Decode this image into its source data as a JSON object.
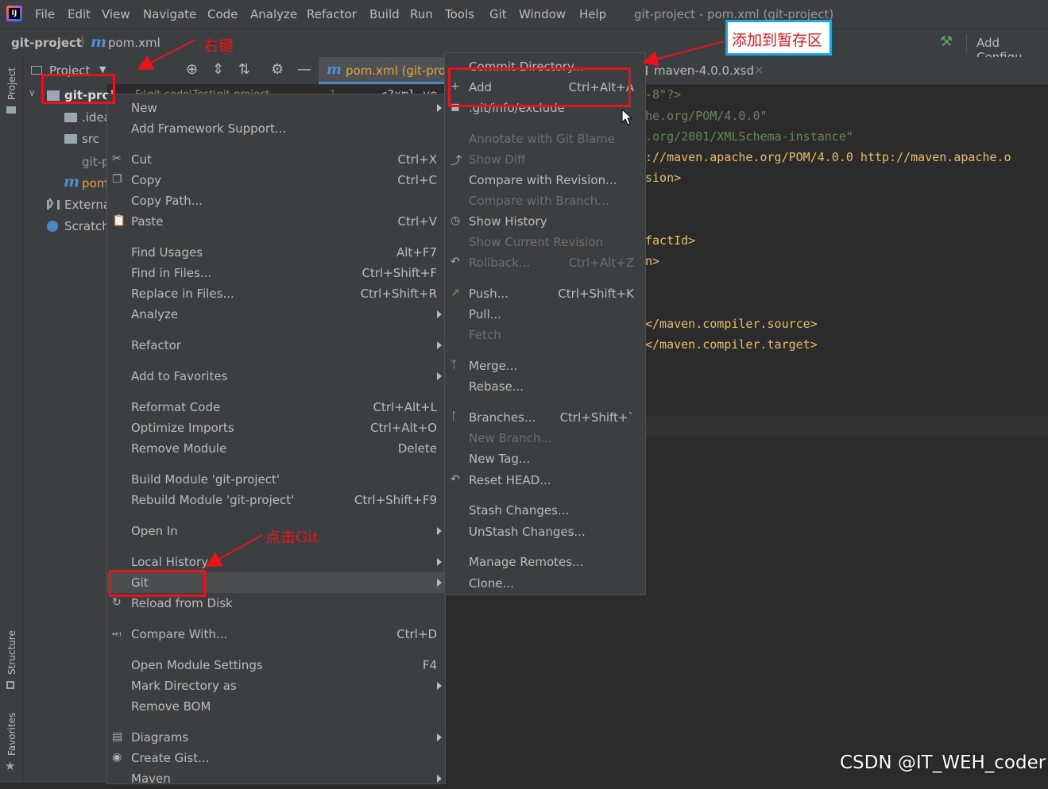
{
  "menubar": {
    "items": [
      "File",
      "Edit",
      "View",
      "Navigate",
      "Code",
      "Analyze",
      "Refactor",
      "Build",
      "Run",
      "Tools",
      "Git",
      "Window",
      "Help"
    ],
    "window_title": "git-project - pom.xml (git-project)"
  },
  "navbar": {
    "project": "git-project",
    "file": "pom.xml",
    "add_config": "Add Configu"
  },
  "tool_windows": {
    "project": "Project",
    "structure": "Structure",
    "favorites": "Favorites"
  },
  "project_panel": {
    "title": "Project",
    "tree": [
      "git-proj",
      "F:\\git-code\\Test\\git-project",
      ".idea",
      "src",
      "git-p",
      "pom",
      "Externa",
      "Scratch"
    ]
  },
  "editor": {
    "tabs": [
      "pom.xml (git-pro",
      "maven-4.0.0.xsd"
    ],
    "lines": [
      "-8\"?>",
      "he.org/POM/4.0.0\"",
      ".org/2001/XMLSchema-instance\"",
      "://maven.apache.org/POM/4.0.0 http://maven.apache.o",
      "sion>",
      "factId>",
      "n>",
      "</maven.compiler.source>",
      "</maven.compiler.target>"
    ],
    "fragment": "<?xml ve"
  },
  "context_menu": {
    "items": [
      {
        "label": "New",
        "shortcut": ""
      },
      {
        "label": "Add Framework Support...",
        "shortcut": ""
      },
      {
        "label": "Cut",
        "shortcut": "Ctrl+X"
      },
      {
        "label": "Copy",
        "shortcut": "Ctrl+C"
      },
      {
        "label": "Copy Path...",
        "shortcut": ""
      },
      {
        "label": "Paste",
        "shortcut": "Ctrl+V"
      },
      {
        "label": "Find Usages",
        "shortcut": "Alt+F7"
      },
      {
        "label": "Find in Files...",
        "shortcut": "Ctrl+Shift+F"
      },
      {
        "label": "Replace in Files...",
        "shortcut": "Ctrl+Shift+R"
      },
      {
        "label": "Analyze",
        "shortcut": ""
      },
      {
        "label": "Refactor",
        "shortcut": ""
      },
      {
        "label": "Add to Favorites",
        "shortcut": ""
      },
      {
        "label": "Reformat Code",
        "shortcut": "Ctrl+Alt+L"
      },
      {
        "label": "Optimize Imports",
        "shortcut": "Ctrl+Alt+O"
      },
      {
        "label": "Remove Module",
        "shortcut": "Delete"
      },
      {
        "label": "Build Module 'git-project'",
        "shortcut": ""
      },
      {
        "label": "Rebuild Module 'git-project'",
        "shortcut": "Ctrl+Shift+F9"
      },
      {
        "label": "Open In",
        "shortcut": ""
      },
      {
        "label": "Local History",
        "shortcut": ""
      },
      {
        "label": "Git",
        "shortcut": ""
      },
      {
        "label": "Reload from Disk",
        "shortcut": ""
      },
      {
        "label": "Compare With...",
        "shortcut": "Ctrl+D"
      },
      {
        "label": "Open Module Settings",
        "shortcut": "F4"
      },
      {
        "label": "Mark Directory as",
        "shortcut": ""
      },
      {
        "label": "Remove BOM",
        "shortcut": ""
      },
      {
        "label": "Diagrams",
        "shortcut": ""
      },
      {
        "label": "Create Gist...",
        "shortcut": ""
      },
      {
        "label": "Maven",
        "shortcut": ""
      }
    ]
  },
  "git_submenu": {
    "items": [
      {
        "label": "Commit Directory...",
        "shortcut": ""
      },
      {
        "label": "Add",
        "shortcut": "Ctrl+Alt+A"
      },
      {
        "label": ".git/info/exclude",
        "shortcut": ""
      },
      {
        "label": "Annotate with Git Blame",
        "shortcut": ""
      },
      {
        "label": "Show Diff",
        "shortcut": ""
      },
      {
        "label": "Compare with Revision...",
        "shortcut": ""
      },
      {
        "label": "Compare with Branch...",
        "shortcut": ""
      },
      {
        "label": "Show History",
        "shortcut": ""
      },
      {
        "label": "Show Current Revision",
        "shortcut": ""
      },
      {
        "label": "Rollback...",
        "shortcut": "Ctrl+Alt+Z"
      },
      {
        "label": "Push...",
        "shortcut": "Ctrl+Shift+K"
      },
      {
        "label": "Pull...",
        "shortcut": ""
      },
      {
        "label": "Fetch",
        "shortcut": ""
      },
      {
        "label": "Merge...",
        "shortcut": ""
      },
      {
        "label": "Rebase...",
        "shortcut": ""
      },
      {
        "label": "Branches...",
        "shortcut": "Ctrl+Shift+`"
      },
      {
        "label": "New Branch...",
        "shortcut": ""
      },
      {
        "label": "New Tag...",
        "shortcut": ""
      },
      {
        "label": "Reset HEAD...",
        "shortcut": ""
      },
      {
        "label": "Stash Changes...",
        "shortcut": ""
      },
      {
        "label": "UnStash Changes...",
        "shortcut": ""
      },
      {
        "label": "Manage Remotes...",
        "shortcut": ""
      },
      {
        "label": "Clone...",
        "shortcut": ""
      }
    ]
  },
  "annotations": {
    "right_click": "右键",
    "add_to_stage": "添加到暂存区",
    "click_git": "点击Git"
  },
  "watermark": "CSDN @IT_WEH_coder",
  "colors": {
    "red_box": "#e8141b",
    "blue_box": "#1aa5e6",
    "menu_bg": "#3c3f41",
    "editor_bg": "#2b2b2b"
  }
}
